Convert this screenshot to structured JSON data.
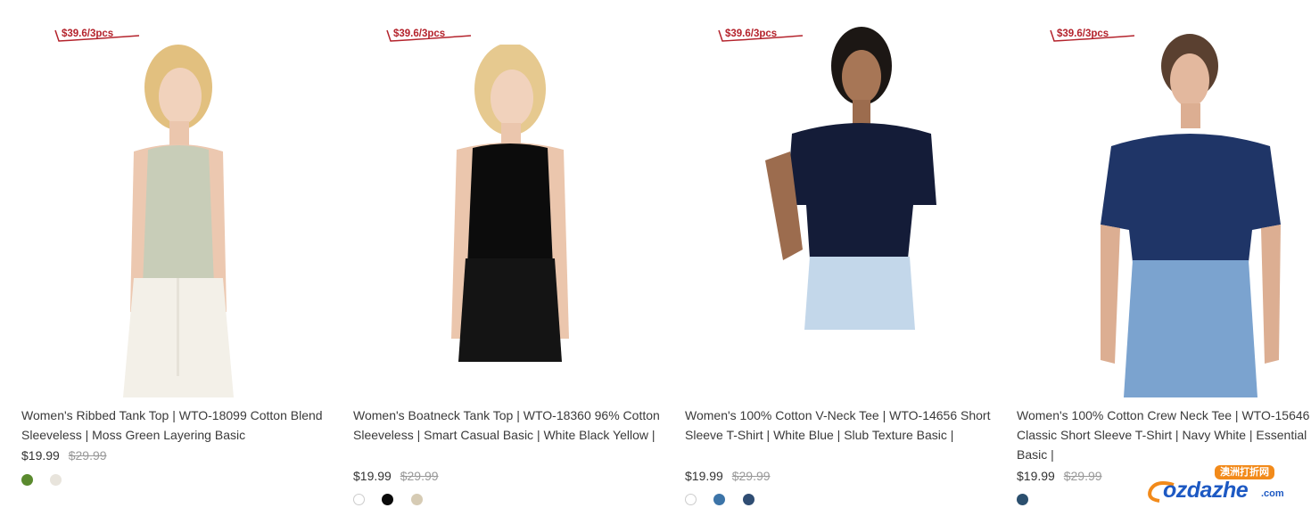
{
  "products": [
    {
      "badge": "$39.6/3pcs",
      "title": "Women's Ribbed Tank Top | WTO-18099 Cotton Blend Sleeveless | Moss Green Layering Basic",
      "price": "$19.99",
      "old_price": "$29.99",
      "swatches": [
        "#5a8a2e",
        "#e8e4dc"
      ]
    },
    {
      "badge": "$39.6/3pcs",
      "title": "Women's Boatneck Tank Top | WTO-18360 96% Cotton Sleeveless | Smart Casual Basic | White Black Yellow |",
      "price": "$19.99",
      "old_price": "$29.99",
      "swatches": [
        "#ffffff",
        "#0a0a0a",
        "#d6cbb4"
      ]
    },
    {
      "badge": "$39.6/3pcs",
      "title": "Women's 100% Cotton V-Neck Tee | WTO-14656 Short Sleeve T-Shirt | White Blue | Slub Texture Basic |",
      "price": "$19.99",
      "old_price": "$29.99",
      "swatches": [
        "#ffffff",
        "#3c74a8",
        "#2f4d73"
      ]
    },
    {
      "badge": "$39.6/3pcs",
      "title": "Women's 100% Cotton Crew Neck Tee | WTO-15646 Classic Short Sleeve T-Shirt | Navy White | Essential Basic |",
      "price": "$19.99",
      "old_price": "$29.99",
      "swatches": [
        "#2b4f6e"
      ]
    }
  ],
  "watermark": {
    "cn_text": "澳洲打折网",
    "main": "ozdazhe",
    "suffix": ".com"
  },
  "colors": {
    "badge_red": "#b4232c",
    "text": "#3a3a3a",
    "strike": "#999999",
    "logo_blue": "#1d59c3",
    "logo_orange": "#f28a1a"
  }
}
